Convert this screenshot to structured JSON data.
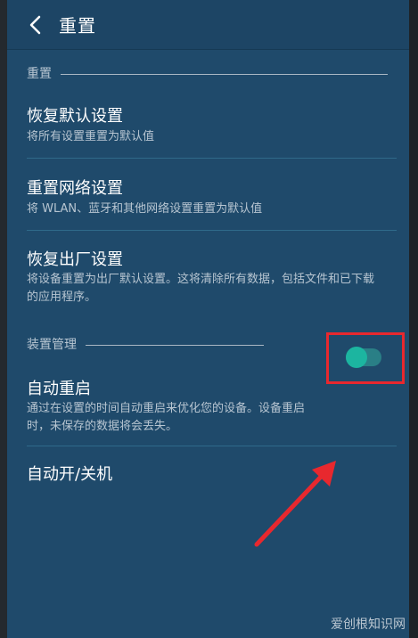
{
  "header": {
    "title": "重置",
    "back_icon": "chevron-left-icon"
  },
  "sections": {
    "reset": {
      "label": "重置",
      "items": [
        {
          "title": "恢复默认设置",
          "subtitle": "将所有设置重置为默认值"
        },
        {
          "title": "重置网络设置",
          "subtitle": "将 WLAN、蓝牙和其他网络设置重置为默认值"
        },
        {
          "title": "恢复出厂设置",
          "subtitle": "将设备重置为出厂默认设置。这将清除所有数据，包括文件和已下载的应用程序。"
        }
      ]
    },
    "device": {
      "label": "装置管理",
      "items": [
        {
          "title": "自动重启",
          "subtitle": "通过在设置的时间自动重启来优化您的设备。设备重启时，未保存的数据将会丢失。",
          "toggle_on": true
        },
        {
          "title": "自动开/关机"
        }
      ]
    }
  },
  "annotations": {
    "highlight_color": "#e8282e",
    "arrow_color": "#e8282e"
  },
  "watermark": "爱创根知识网",
  "colors": {
    "background": "#1f4a6b",
    "accent": "#1cb5a0"
  }
}
